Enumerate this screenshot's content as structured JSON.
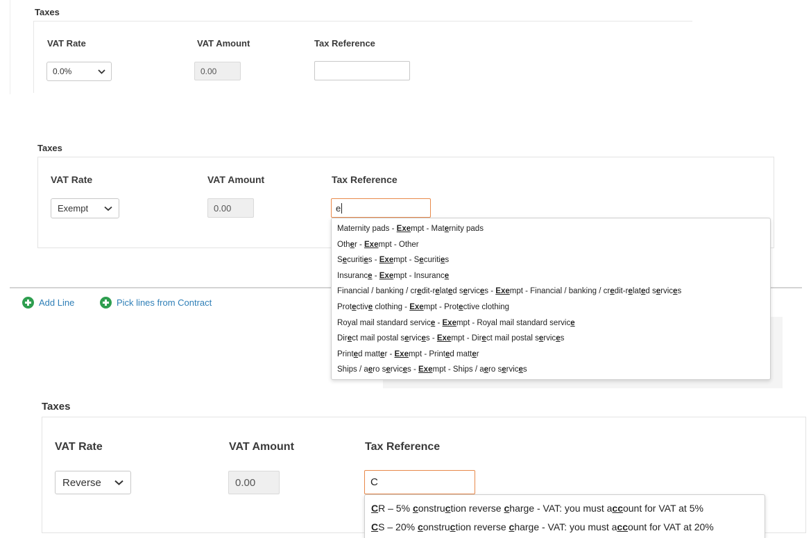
{
  "section1": {
    "title": "Taxes",
    "vat_rate_label": "VAT Rate",
    "vat_amount_label": "VAT Amount",
    "tax_reference_label": "Tax Reference",
    "vat_rate_value": "0.0%",
    "vat_amount_value": "0.00",
    "tax_reference_value": ""
  },
  "section2": {
    "title": "Taxes",
    "vat_rate_label": "VAT Rate",
    "vat_amount_label": "VAT Amount",
    "tax_reference_label": "Tax Reference",
    "vat_rate_value": "Exempt",
    "vat_amount_value": "0.00",
    "tax_reference_value": "e",
    "suggestions": [
      [
        [
          "Mat",
          ""
        ],
        [
          "e",
          ""
        ],
        [
          "rnity pads - ",
          ""
        ],
        [
          "Exe",
          "u"
        ],
        [
          "mpt - Mat",
          ""
        ],
        [
          "e",
          "u"
        ],
        [
          "rnity pads",
          ""
        ]
      ],
      [
        [
          "Oth",
          ""
        ],
        [
          "e",
          "u"
        ],
        [
          "r - ",
          ""
        ],
        [
          "Exe",
          "u"
        ],
        [
          "mpt - Other",
          ""
        ]
      ],
      [
        [
          "S",
          ""
        ],
        [
          "e",
          "u"
        ],
        [
          "curiti",
          ""
        ],
        [
          "e",
          "u"
        ],
        [
          "s - ",
          ""
        ],
        [
          "Exe",
          "u"
        ],
        [
          "mpt - S",
          ""
        ],
        [
          "e",
          "u"
        ],
        [
          "curiti",
          ""
        ],
        [
          "e",
          "u"
        ],
        [
          "s",
          ""
        ]
      ],
      [
        [
          "Insuranc",
          ""
        ],
        [
          "e",
          "u"
        ],
        [
          " - ",
          ""
        ],
        [
          "Exe",
          "u"
        ],
        [
          "mpt - Insuranc",
          ""
        ],
        [
          "e",
          "u"
        ]
      ],
      [
        [
          "Financial / banking / cr",
          ""
        ],
        [
          "e",
          "u"
        ],
        [
          "dit-r",
          ""
        ],
        [
          "e",
          "u"
        ],
        [
          "lat",
          ""
        ],
        [
          "e",
          "u"
        ],
        [
          "d s",
          ""
        ],
        [
          "e",
          "u"
        ],
        [
          "rvic",
          ""
        ],
        [
          "e",
          "u"
        ],
        [
          "s - ",
          ""
        ],
        [
          "Exe",
          "u"
        ],
        [
          "mpt - Financial / banking / cr",
          ""
        ],
        [
          "e",
          "u"
        ],
        [
          "dit-r",
          ""
        ],
        [
          "e",
          "u"
        ],
        [
          "lat",
          ""
        ],
        [
          "e",
          "u"
        ],
        [
          "d s",
          ""
        ],
        [
          "e",
          "u"
        ],
        [
          "rvic",
          ""
        ],
        [
          "e",
          "u"
        ],
        [
          "s",
          ""
        ]
      ],
      [
        [
          "Prot",
          ""
        ],
        [
          "e",
          "u"
        ],
        [
          "ctiv",
          ""
        ],
        [
          "e",
          "u"
        ],
        [
          " clothing - ",
          ""
        ],
        [
          "Exe",
          "u"
        ],
        [
          "mpt - Prot",
          ""
        ],
        [
          "e",
          "u"
        ],
        [
          "ctive clothing",
          ""
        ]
      ],
      [
        [
          "Royal mail standard servic",
          ""
        ],
        [
          "e",
          "u"
        ],
        [
          " - ",
          ""
        ],
        [
          "Exe",
          "u"
        ],
        [
          "mpt - Royal mail standard servic",
          ""
        ],
        [
          "e",
          "u"
        ]
      ],
      [
        [
          "Dir",
          ""
        ],
        [
          "e",
          "u"
        ],
        [
          "ct mail postal s",
          ""
        ],
        [
          "e",
          "u"
        ],
        [
          "rvic",
          ""
        ],
        [
          "e",
          "u"
        ],
        [
          "s - ",
          ""
        ],
        [
          "Exe",
          "u"
        ],
        [
          "mpt - Dir",
          ""
        ],
        [
          "e",
          "u"
        ],
        [
          "ct mail postal s",
          ""
        ],
        [
          "e",
          "u"
        ],
        [
          "rvic",
          ""
        ],
        [
          "e",
          "u"
        ],
        [
          "s",
          ""
        ]
      ],
      [
        [
          "Print",
          ""
        ],
        [
          "e",
          "u"
        ],
        [
          "d matt",
          ""
        ],
        [
          "e",
          "u"
        ],
        [
          "r - ",
          ""
        ],
        [
          "Exe",
          "u"
        ],
        [
          "mpt - Print",
          ""
        ],
        [
          "e",
          "u"
        ],
        [
          "d matt",
          ""
        ],
        [
          "e",
          "u"
        ],
        [
          "r",
          ""
        ]
      ],
      [
        [
          "Ships / a",
          ""
        ],
        [
          "e",
          "u"
        ],
        [
          "ro s",
          ""
        ],
        [
          "e",
          "u"
        ],
        [
          "rvic",
          ""
        ],
        [
          "e",
          "u"
        ],
        [
          "s - ",
          ""
        ],
        [
          "Exe",
          "u"
        ],
        [
          "mpt - Ships / a",
          ""
        ],
        [
          "e",
          "u"
        ],
        [
          "ro s",
          ""
        ],
        [
          "e",
          "u"
        ],
        [
          "rvic",
          ""
        ],
        [
          "e",
          "u"
        ],
        [
          "s",
          ""
        ]
      ]
    ]
  },
  "actions": {
    "add_line": "Add Line",
    "pick_lines": "Pick lines from Contract"
  },
  "section3": {
    "title": "Taxes",
    "vat_rate_label": "VAT Rate",
    "vat_amount_label": "VAT Amount",
    "tax_reference_label": "Tax Reference",
    "vat_rate_value": "Reverse",
    "vat_amount_value": "0.00",
    "tax_reference_value": "C",
    "suggestions": [
      [
        [
          "C",
          "u"
        ],
        [
          "R – 5% ",
          ""
        ],
        [
          "c",
          "u"
        ],
        [
          "onstru",
          ""
        ],
        [
          "c",
          "u"
        ],
        [
          "tion reverse ",
          ""
        ],
        [
          "c",
          "u"
        ],
        [
          "harge - VAT: you must a",
          ""
        ],
        [
          "cc",
          "u"
        ],
        [
          "ount for VAT at 5%",
          ""
        ]
      ],
      [
        [
          "C",
          "u"
        ],
        [
          "S – 20% ",
          ""
        ],
        [
          "c",
          "u"
        ],
        [
          "onstru",
          ""
        ],
        [
          "c",
          "u"
        ],
        [
          "tion reverse ",
          ""
        ],
        [
          "c",
          "u"
        ],
        [
          "harge - VAT: you must a",
          ""
        ],
        [
          "cc",
          "u"
        ],
        [
          "ount for VAT at 20%",
          ""
        ]
      ]
    ]
  },
  "colors": {
    "focus_border": "#e8894a",
    "link": "#2f7fb7",
    "add_icon": "#2e9e4f"
  }
}
